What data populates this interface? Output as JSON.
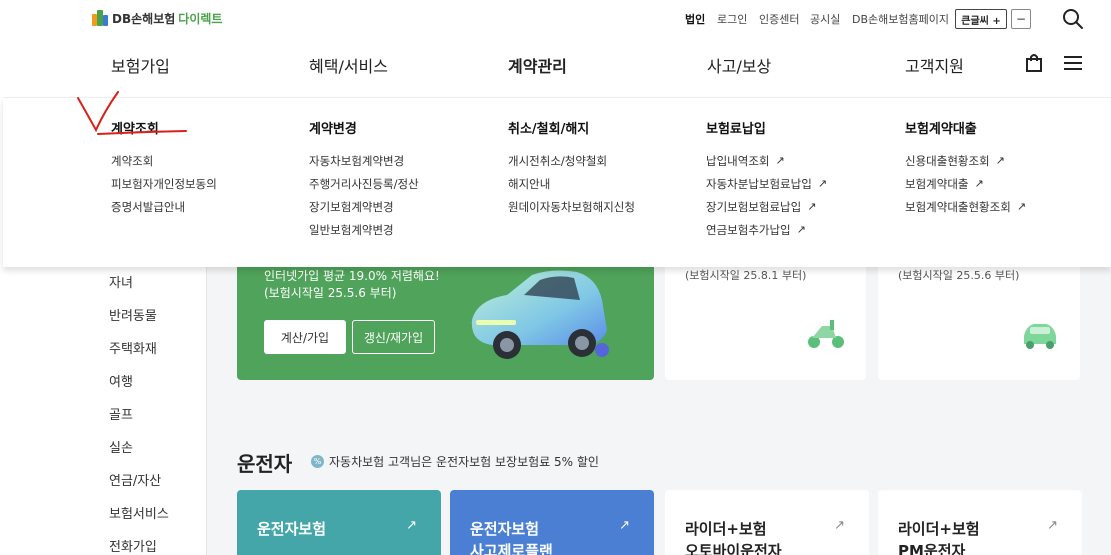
{
  "header": {
    "logo": {
      "brand": "DB손해보험",
      "sub": "다이렉트"
    },
    "util_links": [
      "법인",
      "로그인",
      "인증센터",
      "공시실",
      "DB손해보험홈페이지"
    ],
    "font_size_up": "큰글씨 +",
    "font_size_down": "−",
    "nav": [
      "보험가입",
      "혜택/서비스",
      "계약관리",
      "사고/보상",
      "고객지원"
    ],
    "active_nav": "계약관리"
  },
  "dropdown": {
    "columns": [
      {
        "title": "계약조회",
        "items": [
          {
            "label": "계약조회",
            "ext": false
          },
          {
            "label": "피보험자개인정보동의",
            "ext": false
          },
          {
            "label": "증명서발급안내",
            "ext": false
          }
        ]
      },
      {
        "title": "계약변경",
        "items": [
          {
            "label": "자동차보험계약변경",
            "ext": false
          },
          {
            "label": "주행거리사진등록/정산",
            "ext": false
          },
          {
            "label": "장기보험계약변경",
            "ext": false
          },
          {
            "label": "일반보험계약변경",
            "ext": false
          }
        ]
      },
      {
        "title": "취소/철회/해지",
        "items": [
          {
            "label": "개시전취소/청약철회",
            "ext": false
          },
          {
            "label": "해지안내",
            "ext": false
          },
          {
            "label": "원데이자동차보험해지신청",
            "ext": false
          }
        ]
      },
      {
        "title": "보험료납입",
        "items": [
          {
            "label": "납입내역조회",
            "ext": true
          },
          {
            "label": "자동차분납보험료납입",
            "ext": true
          },
          {
            "label": "장기보험보험료납입",
            "ext": true
          },
          {
            "label": "연금보험추가납입",
            "ext": true
          }
        ]
      },
      {
        "title": "보험계약대출",
        "items": [
          {
            "label": "신용대출현황조회",
            "ext": true
          },
          {
            "label": "보험계약대출",
            "ext": true
          },
          {
            "label": "보험계약대출현황조회",
            "ext": true
          }
        ]
      }
    ],
    "ext_glyph": "↗"
  },
  "sidebar": {
    "items": [
      "자녀",
      "반려동물",
      "주택화재",
      "여행",
      "골프",
      "실손",
      "연금/자산",
      "보험서비스",
      "전화가입"
    ]
  },
  "hero": {
    "line1": "인터넷가입 평균 19.0% 저렴해요!",
    "line2": "(보험시작일 25.5.6 부터)",
    "btn_primary": "계산/가입",
    "btn_secondary": "갱신/재가입",
    "color": "#4fa35a"
  },
  "cards": [
    {
      "sub": "(보험시작일 25.8.1 부터)",
      "icon": "scooter-icon"
    },
    {
      "sub": "(보험시작일 25.5.6 부터)",
      "icon": "car-icon"
    }
  ],
  "section": {
    "title": "운전자",
    "note": "자동차보험 고객님은 운전자보험 보장보험료 5% 할인"
  },
  "products": [
    {
      "line1": "운전자보험",
      "line2": "",
      "style": "teal"
    },
    {
      "line1": "운전자보험",
      "line2": "사고제로플랜",
      "style": "blue"
    },
    {
      "line1": "라이더+보험",
      "line2": "오토바이운전자",
      "style": "white"
    },
    {
      "line1": "라이더+보험",
      "line2": "PM운전자",
      "style": "white"
    }
  ],
  "arrow_glyph": "↗",
  "colors": {
    "accent_green": "#4aa34a",
    "hero_green": "#4fa35a",
    "teal": "#44a6a8",
    "blue": "#4a7fd3",
    "annotation_red": "#d9201c"
  }
}
